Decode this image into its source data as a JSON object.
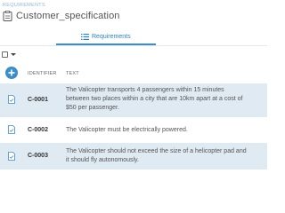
{
  "breadcrumb": "REQUIREMENTS",
  "title": "Customer_specification",
  "tabs": [
    {
      "label": "Requirements",
      "active": true
    }
  ],
  "table": {
    "columns": [
      "IDENTIFIER",
      "TEXT"
    ],
    "rows": [
      {
        "id": "C-0001",
        "text_lines": [
          "The Valicopter transports 4 passengers within 15 minutes",
          "between two places within a city that are 10km apart at a cost of",
          "$50 per passenger."
        ]
      },
      {
        "id": "C-0002",
        "text_lines": [
          "The Valicopter must be electrically powered."
        ]
      },
      {
        "id": "C-0003",
        "text_lines": [
          "The Valicopter should not exceed the size of a helicopter pad and",
          "it should fly autonomously."
        ]
      }
    ]
  },
  "colors": {
    "accent": "#3d8dc6",
    "row_highlight": "#dfeaf3",
    "breadcrumb": "#8fb6d4"
  },
  "icons": {
    "title": "document-icon",
    "tab": "list-icon",
    "add": "plus-icon",
    "row": "requirement-document-icon",
    "select_menu": "caret-down-icon"
  }
}
